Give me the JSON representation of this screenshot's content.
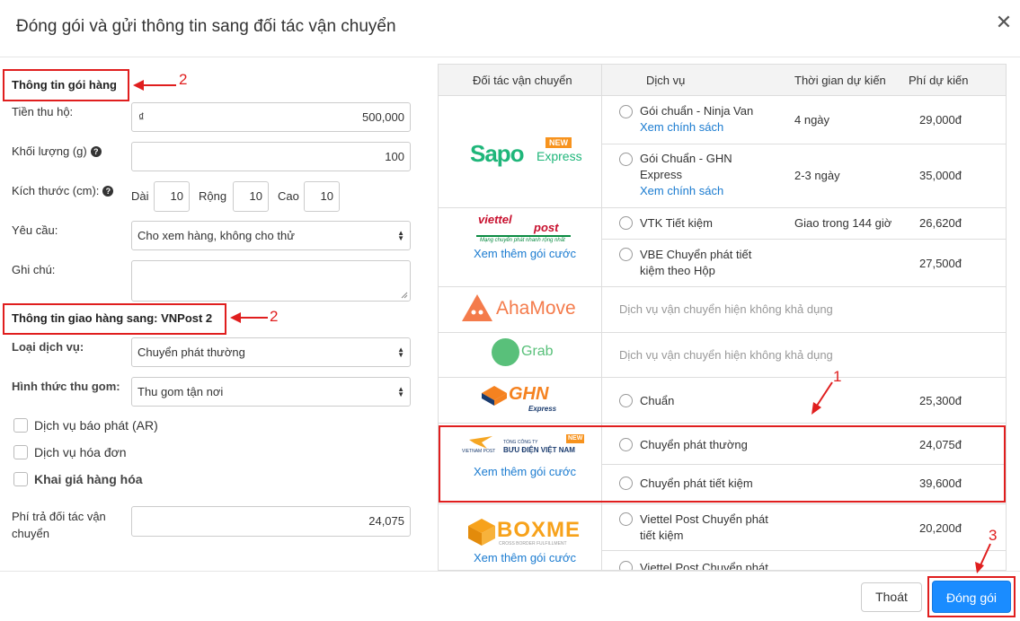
{
  "modal": {
    "title": "Đóng gói và gửi thông tin sang đối tác vận chuyển"
  },
  "left": {
    "package_title": "Thông tin gói hàng",
    "cod_label": "Tiền thu hộ:",
    "cod_currency": "₫",
    "cod_value": "500,000",
    "weight_label": "Khối lượng (g)",
    "weight_value": "100",
    "size_label": "Kích thước (cm):",
    "length_label": "Dài",
    "length_value": "10",
    "width_label": "Rộng",
    "width_value": "10",
    "height_label": "Cao",
    "height_value": "10",
    "request_label": "Yêu cầu:",
    "request_value": "Cho xem hàng, không cho thử",
    "note_label": "Ghi chú:",
    "shipping_title": "Thông tin giao hàng sang: VNPost 2",
    "service_type_label": "Loại dịch vụ:",
    "service_type_value": "Chuyển phát thường",
    "pickup_label": "Hình thức thu gom:",
    "pickup_value": "Thu gom tận nơi",
    "cb_ar": "Dịch vụ báo phát (AR)",
    "cb_invoice": "Dịch vụ hóa đơn",
    "cb_declare": "Khai giá hàng hóa",
    "fee_label_1": "Phí trả đối tác vận",
    "fee_label_2": "chuyển",
    "fee_value": "24,075"
  },
  "table": {
    "headers": [
      "Đối tác vận chuyển",
      "Dịch vụ",
      "Thời gian dự kiến",
      "Phí dự kiến"
    ],
    "sapo": {
      "logo_main": "Sapo",
      "logo_sub": "Express",
      "logo_badge": "NEW",
      "rows": [
        {
          "service": "Gói chuẩn - Ninja Van",
          "link": "Xem chính sách",
          "time": "4 ngày",
          "fee": "29,000đ"
        },
        {
          "service_1": "Gói Chuẩn - GHN",
          "service_2": "Express",
          "link": "Xem chính sách",
          "time": "2-3 ngày",
          "fee": "35,000đ"
        }
      ]
    },
    "viettel": {
      "logo_main": "viettel",
      "logo_sub": "post",
      "logo_tag": "Mạng chuyển phát nhanh rộng nhất",
      "link": "Xem thêm gói cước",
      "rows": [
        {
          "service": "VTK Tiết kiệm",
          "time": "Giao trong 144 giờ",
          "fee": "26,620đ"
        },
        {
          "service_1": "VBE Chuyển phát tiết",
          "service_2": "kiệm theo Hộp",
          "fee": "27,500đ"
        }
      ]
    },
    "ahamove": {
      "logo": "AhaMove",
      "unavailable": "Dịch vụ vận chuyển hiện không khả dụng"
    },
    "grab": {
      "logo": "Grab",
      "unavailable": "Dịch vụ vận chuyển hiện không khả dụng"
    },
    "ghn": {
      "logo": "GHN",
      "logo_sub": "Express",
      "rows": [
        {
          "service": "Chuẩn",
          "fee": "25,300đ"
        }
      ]
    },
    "vnpost": {
      "logo_left": "VIETNAM POST",
      "logo_top": "TỔNG CÔNG TY",
      "logo_main": "BƯU ĐIỆN VIỆT NAM",
      "logo_badge": "NEW",
      "link": "Xem thêm gói cước",
      "rows": [
        {
          "service": "Chuyển phát thường",
          "fee": "24,075đ"
        },
        {
          "service": "Chuyển phát tiết kiệm",
          "fee": "39,600đ"
        }
      ]
    },
    "boxme": {
      "logo": "BOXME",
      "logo_sub": "CROSS BORDER FULFILLMENT",
      "link": "Xem thêm gói cước",
      "rows": [
        {
          "service_1": "Viettel Post Chuyển phát",
          "service_2": "tiết kiệm",
          "fee": "20,200đ"
        },
        {
          "service": "Viettel Post Chuyển phát"
        }
      ]
    }
  },
  "annotations": {
    "n1": "1",
    "n2a": "2",
    "n2b": "2",
    "n3": "3"
  },
  "footer": {
    "cancel": "Thoát",
    "submit": "Đóng gói"
  },
  "colors": {
    "primary": "#1a8cff",
    "annotation": "#e01e1e",
    "link": "#1a7bd0"
  }
}
